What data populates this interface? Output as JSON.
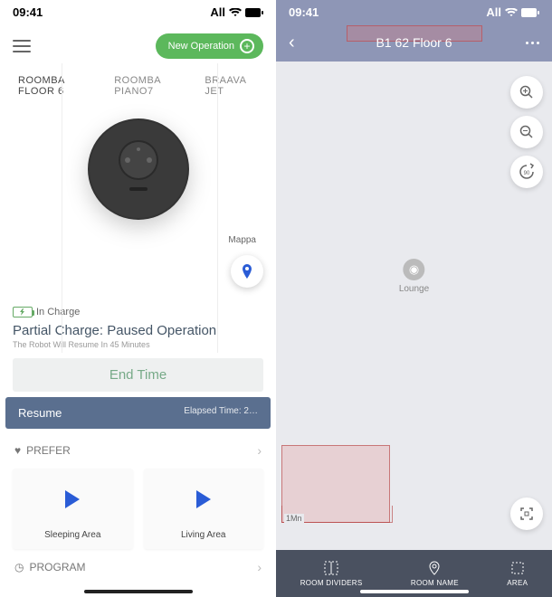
{
  "status": {
    "time": "09:41",
    "carrier": "All"
  },
  "left": {
    "new_op": "New Operation",
    "tabs": [
      "ROOMBA FLOOR 6",
      "ROOMBA PIANO7",
      "BRAAVA JET"
    ],
    "map_label": "Mappa",
    "charge_label": "In Charge",
    "title": "Partial Charge: Paused Operation",
    "subtitle": "The Robot Will Resume In 45 Minutes",
    "endtime_btn": "End Time",
    "resume_btn": "Resume",
    "elapsed": "Elapsed Time: 2…",
    "prefer": "PREFER",
    "cards": [
      {
        "label": "Sleeping Area"
      },
      {
        "label": "Living Area"
      }
    ],
    "program": "PROGRAM"
  },
  "right": {
    "title": "B1 62 Floor 6",
    "lounge": "Lounge",
    "dim": "1Mn",
    "bottom": [
      "ROOM DIVIDERS",
      "ROOM NAME",
      "AREA"
    ]
  }
}
